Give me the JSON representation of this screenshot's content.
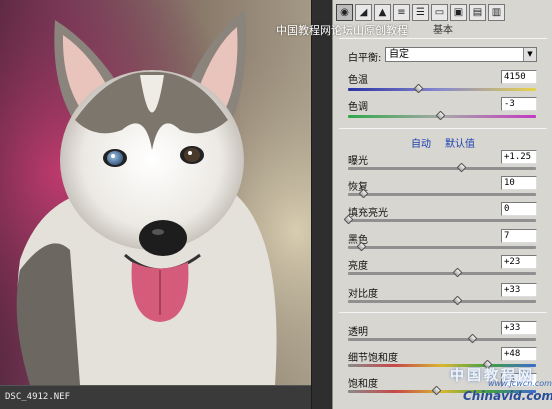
{
  "preview": {
    "filename": "DSC_4912.NEF",
    "photo_alt": "husky puppy photo"
  },
  "watermark": {
    "top_text": "中国教程网论坛山原创教程",
    "bottom_cn": "中国教程网",
    "bottom_url": "www.jcwcn.com",
    "bottom_logo": "Chinavid.com"
  },
  "panel": {
    "title": "基本",
    "toolbar_icons": [
      "aperture-icon",
      "tone-curve-icon",
      "detail-icon",
      "hsl-icon",
      "split-tone-icon",
      "lens-icon",
      "camera-icon",
      "presets-icon",
      "snapshot-icon"
    ],
    "white_balance": {
      "label": "白平衡:",
      "value": "自定"
    },
    "temperature": {
      "label": "色温",
      "value": "4150",
      "position": 0.37
    },
    "tint": {
      "label": "色调",
      "value": "-3",
      "position": 0.49
    },
    "links": {
      "auto": "自动",
      "default": "默认值"
    },
    "exposure": {
      "label": "曝光",
      "value": "+1.25",
      "position": 0.6
    },
    "recovery": {
      "label": "恢复",
      "value": "10",
      "position": 0.08
    },
    "fill_light": {
      "label": "填充亮光",
      "value": "0",
      "position": 0.0
    },
    "blacks": {
      "label": "黑色",
      "value": "7",
      "position": 0.07
    },
    "brightness": {
      "label": "亮度",
      "value": "+23",
      "position": 0.58
    },
    "contrast": {
      "label": "对比度",
      "value": "+33",
      "position": 0.58
    },
    "clarity": {
      "label": "透明",
      "value": "+33",
      "position": 0.66
    },
    "vibrance": {
      "label": "细节饱和度",
      "value": "+48",
      "position": 0.74
    },
    "saturation": {
      "label": "饱和度",
      "value": "-6",
      "position": 0.47
    }
  },
  "colors": {
    "panel_bg": "#d8d6d0",
    "link": "#1b3fb0"
  }
}
